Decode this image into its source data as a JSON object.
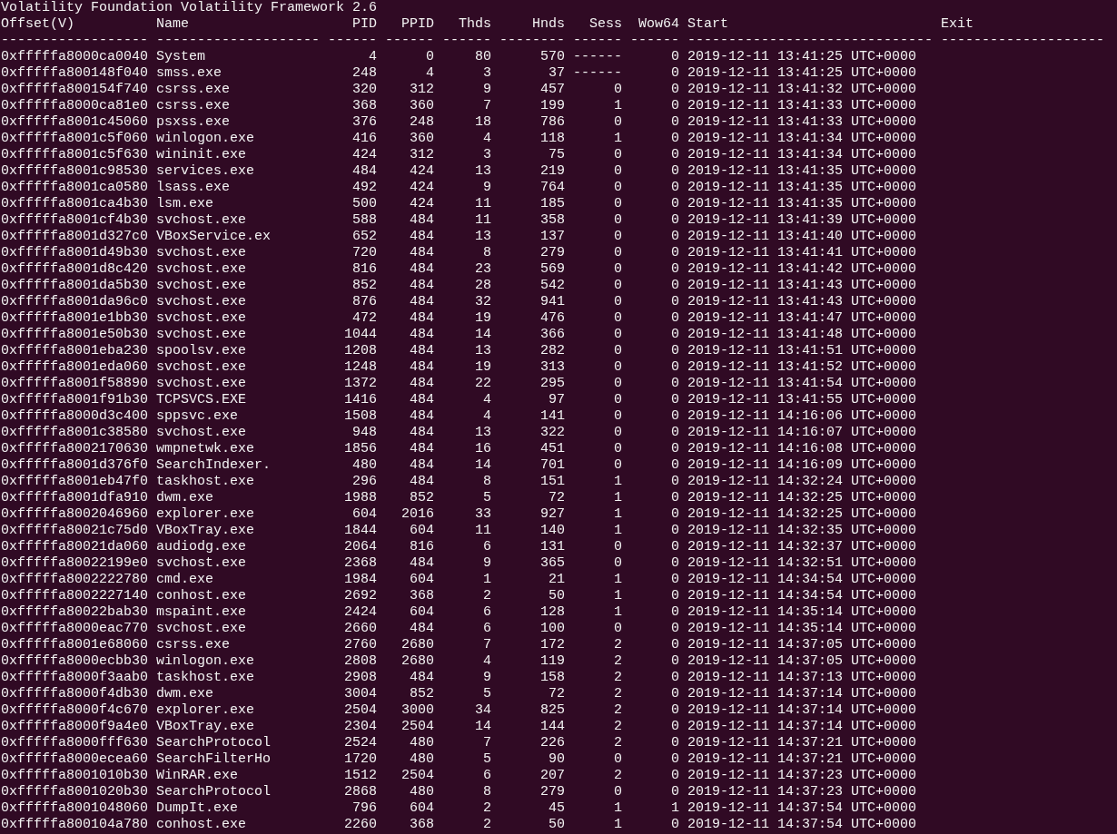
{
  "terminal": {
    "banner": "Volatility Foundation Volatility Framework 2.6",
    "columns": [
      {
        "label": "Offset(V)",
        "rule": "------------------"
      },
      {
        "label": "Name",
        "rule": "--------------------"
      },
      {
        "label": "PID",
        "rule": "------"
      },
      {
        "label": "PPID",
        "rule": "------"
      },
      {
        "label": "Thds",
        "rule": "------"
      },
      {
        "label": "Hnds",
        "rule": "--------"
      },
      {
        "label": "Sess",
        "rule": "------"
      },
      {
        "label": "Wow64",
        "rule": "------"
      },
      {
        "label": "Start",
        "rule": "------------------------------"
      },
      {
        "label": "Exit",
        "rule": "--------------------"
      }
    ],
    "rows": [
      [
        "0xfffffa8000ca0040",
        "System",
        "4",
        "0",
        "80",
        "570",
        "------",
        "0",
        "2019-12-11 13:41:25 UTC+0000"
      ],
      [
        "0xfffffa800148f040",
        "smss.exe",
        "248",
        "4",
        "3",
        "37",
        "------",
        "0",
        "2019-12-11 13:41:25 UTC+0000"
      ],
      [
        "0xfffffa800154f740",
        "csrss.exe",
        "320",
        "312",
        "9",
        "457",
        "0",
        "0",
        "2019-12-11 13:41:32 UTC+0000"
      ],
      [
        "0xfffffa8000ca81e0",
        "csrss.exe",
        "368",
        "360",
        "7",
        "199",
        "1",
        "0",
        "2019-12-11 13:41:33 UTC+0000"
      ],
      [
        "0xfffffa8001c45060",
        "psxss.exe",
        "376",
        "248",
        "18",
        "786",
        "0",
        "0",
        "2019-12-11 13:41:33 UTC+0000"
      ],
      [
        "0xfffffa8001c5f060",
        "winlogon.exe",
        "416",
        "360",
        "4",
        "118",
        "1",
        "0",
        "2019-12-11 13:41:34 UTC+0000"
      ],
      [
        "0xfffffa8001c5f630",
        "wininit.exe",
        "424",
        "312",
        "3",
        "75",
        "0",
        "0",
        "2019-12-11 13:41:34 UTC+0000"
      ],
      [
        "0xfffffa8001c98530",
        "services.exe",
        "484",
        "424",
        "13",
        "219",
        "0",
        "0",
        "2019-12-11 13:41:35 UTC+0000"
      ],
      [
        "0xfffffa8001ca0580",
        "lsass.exe",
        "492",
        "424",
        "9",
        "764",
        "0",
        "0",
        "2019-12-11 13:41:35 UTC+0000"
      ],
      [
        "0xfffffa8001ca4b30",
        "lsm.exe",
        "500",
        "424",
        "11",
        "185",
        "0",
        "0",
        "2019-12-11 13:41:35 UTC+0000"
      ],
      [
        "0xfffffa8001cf4b30",
        "svchost.exe",
        "588",
        "484",
        "11",
        "358",
        "0",
        "0",
        "2019-12-11 13:41:39 UTC+0000"
      ],
      [
        "0xfffffa8001d327c0",
        "VBoxService.ex",
        "652",
        "484",
        "13",
        "137",
        "0",
        "0",
        "2019-12-11 13:41:40 UTC+0000"
      ],
      [
        "0xfffffa8001d49b30",
        "svchost.exe",
        "720",
        "484",
        "8",
        "279",
        "0",
        "0",
        "2019-12-11 13:41:41 UTC+0000"
      ],
      [
        "0xfffffa8001d8c420",
        "svchost.exe",
        "816",
        "484",
        "23",
        "569",
        "0",
        "0",
        "2019-12-11 13:41:42 UTC+0000"
      ],
      [
        "0xfffffa8001da5b30",
        "svchost.exe",
        "852",
        "484",
        "28",
        "542",
        "0",
        "0",
        "2019-12-11 13:41:43 UTC+0000"
      ],
      [
        "0xfffffa8001da96c0",
        "svchost.exe",
        "876",
        "484",
        "32",
        "941",
        "0",
        "0",
        "2019-12-11 13:41:43 UTC+0000"
      ],
      [
        "0xfffffa8001e1bb30",
        "svchost.exe",
        "472",
        "484",
        "19",
        "476",
        "0",
        "0",
        "2019-12-11 13:41:47 UTC+0000"
      ],
      [
        "0xfffffa8001e50b30",
        "svchost.exe",
        "1044",
        "484",
        "14",
        "366",
        "0",
        "0",
        "2019-12-11 13:41:48 UTC+0000"
      ],
      [
        "0xfffffa8001eba230",
        "spoolsv.exe",
        "1208",
        "484",
        "13",
        "282",
        "0",
        "0",
        "2019-12-11 13:41:51 UTC+0000"
      ],
      [
        "0xfffffa8001eda060",
        "svchost.exe",
        "1248",
        "484",
        "19",
        "313",
        "0",
        "0",
        "2019-12-11 13:41:52 UTC+0000"
      ],
      [
        "0xfffffa8001f58890",
        "svchost.exe",
        "1372",
        "484",
        "22",
        "295",
        "0",
        "0",
        "2019-12-11 13:41:54 UTC+0000"
      ],
      [
        "0xfffffa8001f91b30",
        "TCPSVCS.EXE",
        "1416",
        "484",
        "4",
        "97",
        "0",
        "0",
        "2019-12-11 13:41:55 UTC+0000"
      ],
      [
        "0xfffffa8000d3c400",
        "sppsvc.exe",
        "1508",
        "484",
        "4",
        "141",
        "0",
        "0",
        "2019-12-11 14:16:06 UTC+0000"
      ],
      [
        "0xfffffa8001c38580",
        "svchost.exe",
        "948",
        "484",
        "13",
        "322",
        "0",
        "0",
        "2019-12-11 14:16:07 UTC+0000"
      ],
      [
        "0xfffffa8002170630",
        "wmpnetwk.exe",
        "1856",
        "484",
        "16",
        "451",
        "0",
        "0",
        "2019-12-11 14:16:08 UTC+0000"
      ],
      [
        "0xfffffa8001d376f0",
        "SearchIndexer.",
        "480",
        "484",
        "14",
        "701",
        "0",
        "0",
        "2019-12-11 14:16:09 UTC+0000"
      ],
      [
        "0xfffffa8001eb47f0",
        "taskhost.exe",
        "296",
        "484",
        "8",
        "151",
        "1",
        "0",
        "2019-12-11 14:32:24 UTC+0000"
      ],
      [
        "0xfffffa8001dfa910",
        "dwm.exe",
        "1988",
        "852",
        "5",
        "72",
        "1",
        "0",
        "2019-12-11 14:32:25 UTC+0000"
      ],
      [
        "0xfffffa8002046960",
        "explorer.exe",
        "604",
        "2016",
        "33",
        "927",
        "1",
        "0",
        "2019-12-11 14:32:25 UTC+0000"
      ],
      [
        "0xfffffa80021c75d0",
        "VBoxTray.exe",
        "1844",
        "604",
        "11",
        "140",
        "1",
        "0",
        "2019-12-11 14:32:35 UTC+0000"
      ],
      [
        "0xfffffa80021da060",
        "audiodg.exe",
        "2064",
        "816",
        "6",
        "131",
        "0",
        "0",
        "2019-12-11 14:32:37 UTC+0000"
      ],
      [
        "0xfffffa80022199e0",
        "svchost.exe",
        "2368",
        "484",
        "9",
        "365",
        "0",
        "0",
        "2019-12-11 14:32:51 UTC+0000"
      ],
      [
        "0xfffffa8002222780",
        "cmd.exe",
        "1984",
        "604",
        "1",
        "21",
        "1",
        "0",
        "2019-12-11 14:34:54 UTC+0000"
      ],
      [
        "0xfffffa8002227140",
        "conhost.exe",
        "2692",
        "368",
        "2",
        "50",
        "1",
        "0",
        "2019-12-11 14:34:54 UTC+0000"
      ],
      [
        "0xfffffa80022bab30",
        "mspaint.exe",
        "2424",
        "604",
        "6",
        "128",
        "1",
        "0",
        "2019-12-11 14:35:14 UTC+0000"
      ],
      [
        "0xfffffa8000eac770",
        "svchost.exe",
        "2660",
        "484",
        "6",
        "100",
        "0",
        "0",
        "2019-12-11 14:35:14 UTC+0000"
      ],
      [
        "0xfffffa8001e68060",
        "csrss.exe",
        "2760",
        "2680",
        "7",
        "172",
        "2",
        "0",
        "2019-12-11 14:37:05 UTC+0000"
      ],
      [
        "0xfffffa8000ecbb30",
        "winlogon.exe",
        "2808",
        "2680",
        "4",
        "119",
        "2",
        "0",
        "2019-12-11 14:37:05 UTC+0000"
      ],
      [
        "0xfffffa8000f3aab0",
        "taskhost.exe",
        "2908",
        "484",
        "9",
        "158",
        "2",
        "0",
        "2019-12-11 14:37:13 UTC+0000"
      ],
      [
        "0xfffffa8000f4db30",
        "dwm.exe",
        "3004",
        "852",
        "5",
        "72",
        "2",
        "0",
        "2019-12-11 14:37:14 UTC+0000"
      ],
      [
        "0xfffffa8000f4c670",
        "explorer.exe",
        "2504",
        "3000",
        "34",
        "825",
        "2",
        "0",
        "2019-12-11 14:37:14 UTC+0000"
      ],
      [
        "0xfffffa8000f9a4e0",
        "VBoxTray.exe",
        "2304",
        "2504",
        "14",
        "144",
        "2",
        "0",
        "2019-12-11 14:37:14 UTC+0000"
      ],
      [
        "0xfffffa8000fff630",
        "SearchProtocol",
        "2524",
        "480",
        "7",
        "226",
        "2",
        "0",
        "2019-12-11 14:37:21 UTC+0000"
      ],
      [
        "0xfffffa8000ecea60",
        "SearchFilterHo",
        "1720",
        "480",
        "5",
        "90",
        "0",
        "0",
        "2019-12-11 14:37:21 UTC+0000"
      ],
      [
        "0xfffffa8001010b30",
        "WinRAR.exe",
        "1512",
        "2504",
        "6",
        "207",
        "2",
        "0",
        "2019-12-11 14:37:23 UTC+0000"
      ],
      [
        "0xfffffa8001020b30",
        "SearchProtocol",
        "2868",
        "480",
        "8",
        "279",
        "0",
        "0",
        "2019-12-11 14:37:23 UTC+0000"
      ],
      [
        "0xfffffa8001048060",
        "DumpIt.exe",
        "796",
        "604",
        "2",
        "45",
        "1",
        "1",
        "2019-12-11 14:37:54 UTC+0000"
      ],
      [
        "0xfffffa800104a780",
        "conhost.exe",
        "2260",
        "368",
        "2",
        "50",
        "1",
        "0",
        "2019-12-11 14:37:54 UTC+0000"
      ]
    ]
  }
}
